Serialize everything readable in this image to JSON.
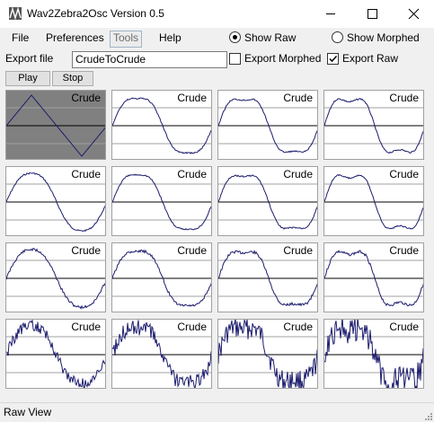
{
  "window": {
    "title": "Wav2Zebra2Osc Version 0.5",
    "controls": {
      "minimize": "minimize-icon",
      "maximize": "maximize-icon",
      "close": "close-icon"
    }
  },
  "menu": {
    "file": "File",
    "preferences": "Preferences",
    "tools": "Tools",
    "help": "Help"
  },
  "view_mode": {
    "show_raw": "Show Raw",
    "show_morphed": "Show Morphed",
    "selected": "show_raw"
  },
  "export": {
    "label": "Export file",
    "filename": "CrudeToCrude",
    "export_morphed_label": "Export Morphed",
    "export_morphed_checked": false,
    "export_raw_label": "Export Raw",
    "export_raw_checked": true
  },
  "transport": {
    "play": "Play",
    "stop": "Stop"
  },
  "cells": [
    "Crude",
    "Crude",
    "Crude",
    "Crude",
    "Crude",
    "Crude",
    "Crude",
    "Crude",
    "Crude",
    "Crude",
    "Crude",
    "Crude",
    "Crude",
    "Crude",
    "Crude",
    "Crude"
  ],
  "selected_cell": 0,
  "status": "Raw View",
  "colors": {
    "wave": "#1c1c6e",
    "selected_bg": "#808080",
    "grid_line": "#a0a0a0"
  }
}
